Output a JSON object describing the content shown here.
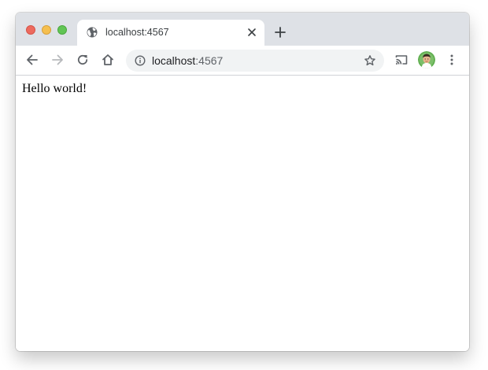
{
  "tab": {
    "title": "localhost:4567",
    "favicon": "globe-icon"
  },
  "omnibox": {
    "host": "localhost",
    "port": ":4567"
  },
  "page": {
    "text": "Hello world!"
  },
  "icons": {
    "back": "arrow-left-icon",
    "forward": "arrow-right-icon",
    "reload": "reload-icon",
    "home": "home-icon",
    "info": "info-icon",
    "bookmark": "star-icon",
    "cast": "cast-icon",
    "menu": "kebab-menu-icon",
    "new_tab": "plus-icon",
    "close_tab": "close-icon"
  },
  "colors": {
    "tabstrip": "#dee1e6",
    "omnibox": "#f1f3f4",
    "traffic_close": "#ed6a5e",
    "traffic_minimize": "#f5bf4f",
    "traffic_maximize": "#61c554",
    "avatar_ring": "#5fae4f"
  }
}
